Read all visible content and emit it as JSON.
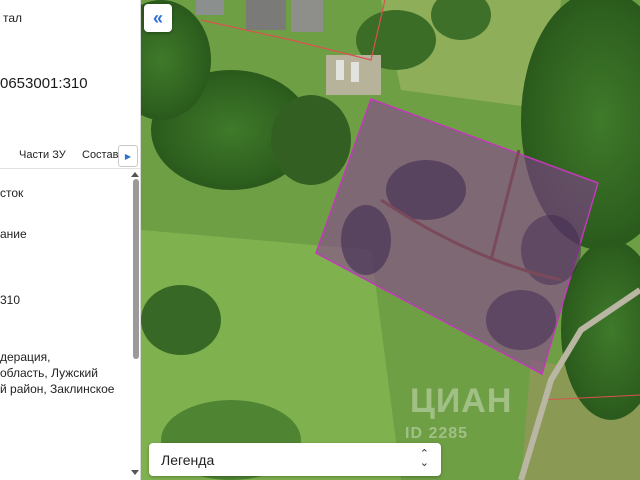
{
  "panel": {
    "title": "тал",
    "cadastral_number": "0653001:310",
    "tabs": [
      {
        "label": "Части ЗУ"
      },
      {
        "label": "Состав"
      }
    ],
    "tab_scroll_icon": "chevron-right-icon",
    "fields": {
      "category": "сток",
      "usage": "ание",
      "number_suffix": "310"
    },
    "address_lines": [
      "дерация,",
      "область, Лужский",
      "й район, Заклинское"
    ]
  },
  "map": {
    "collapse_icon": "double-chevron-left-icon",
    "legend": {
      "label": "Легенда",
      "icon": "up-down-chevron-icon"
    },
    "watermark": {
      "text": "ЦИАН",
      "id": "ID 2285"
    },
    "colors": {
      "parcel_border": "#c03ab8",
      "parcel_fill": "#8a3a9a",
      "neighbor_border": "#d9534f",
      "accent": "#2f6fd6"
    }
  }
}
